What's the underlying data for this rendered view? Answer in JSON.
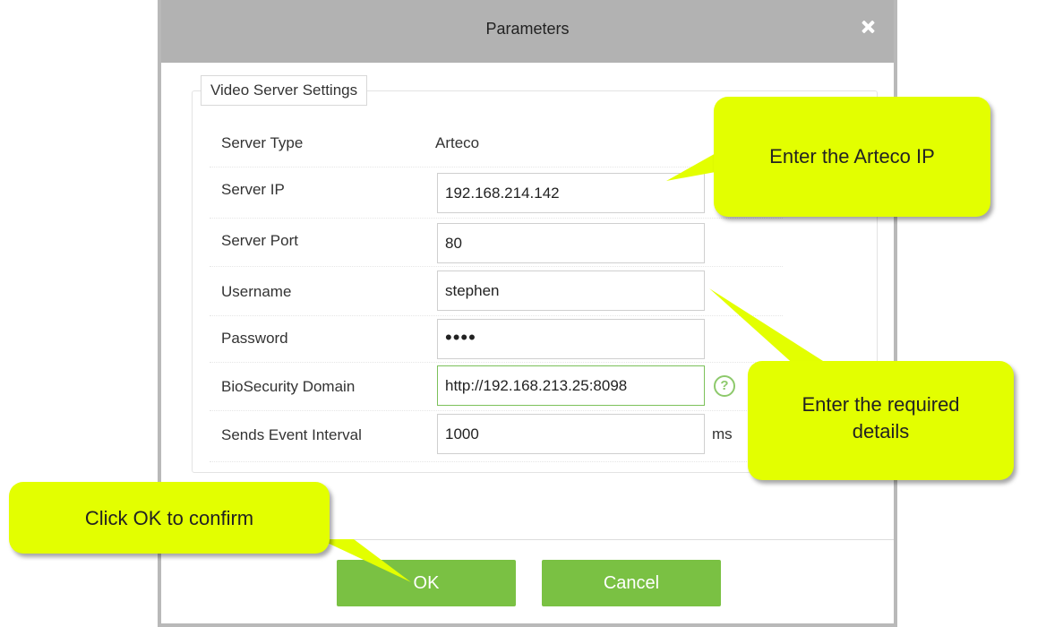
{
  "dialog": {
    "title": "Parameters",
    "section_legend": "Video Server Settings",
    "server_type": {
      "label": "Server Type",
      "value": "Arteco"
    },
    "server_ip": {
      "label": "Server IP",
      "value": "192.168.214.142"
    },
    "server_port": {
      "label": "Server Port",
      "value": "80"
    },
    "username": {
      "label": "Username",
      "value": "stephen"
    },
    "password": {
      "label": "Password",
      "value": "••••"
    },
    "biosecurity_domain": {
      "label": "BioSecurity Domain",
      "value": "http://192.168.213.25:8098"
    },
    "event_interval": {
      "label": "Sends Event Interval",
      "value": "1000",
      "unit": "ms"
    },
    "help_symbol": "?",
    "ok_label": "OK",
    "cancel_label": "Cancel"
  },
  "callouts": {
    "ip": "Enter the Arteco IP",
    "details_line1": "Enter the required",
    "details_line2": "details",
    "ok": "Click OK to confirm"
  },
  "colors": {
    "title_bar": "#b2b2b2",
    "button_green": "#7ac143",
    "callout_yellow": "#e3ff00",
    "active_border": "#7cc15a"
  },
  "icons": {
    "close": "close-icon",
    "help": "help-icon"
  }
}
